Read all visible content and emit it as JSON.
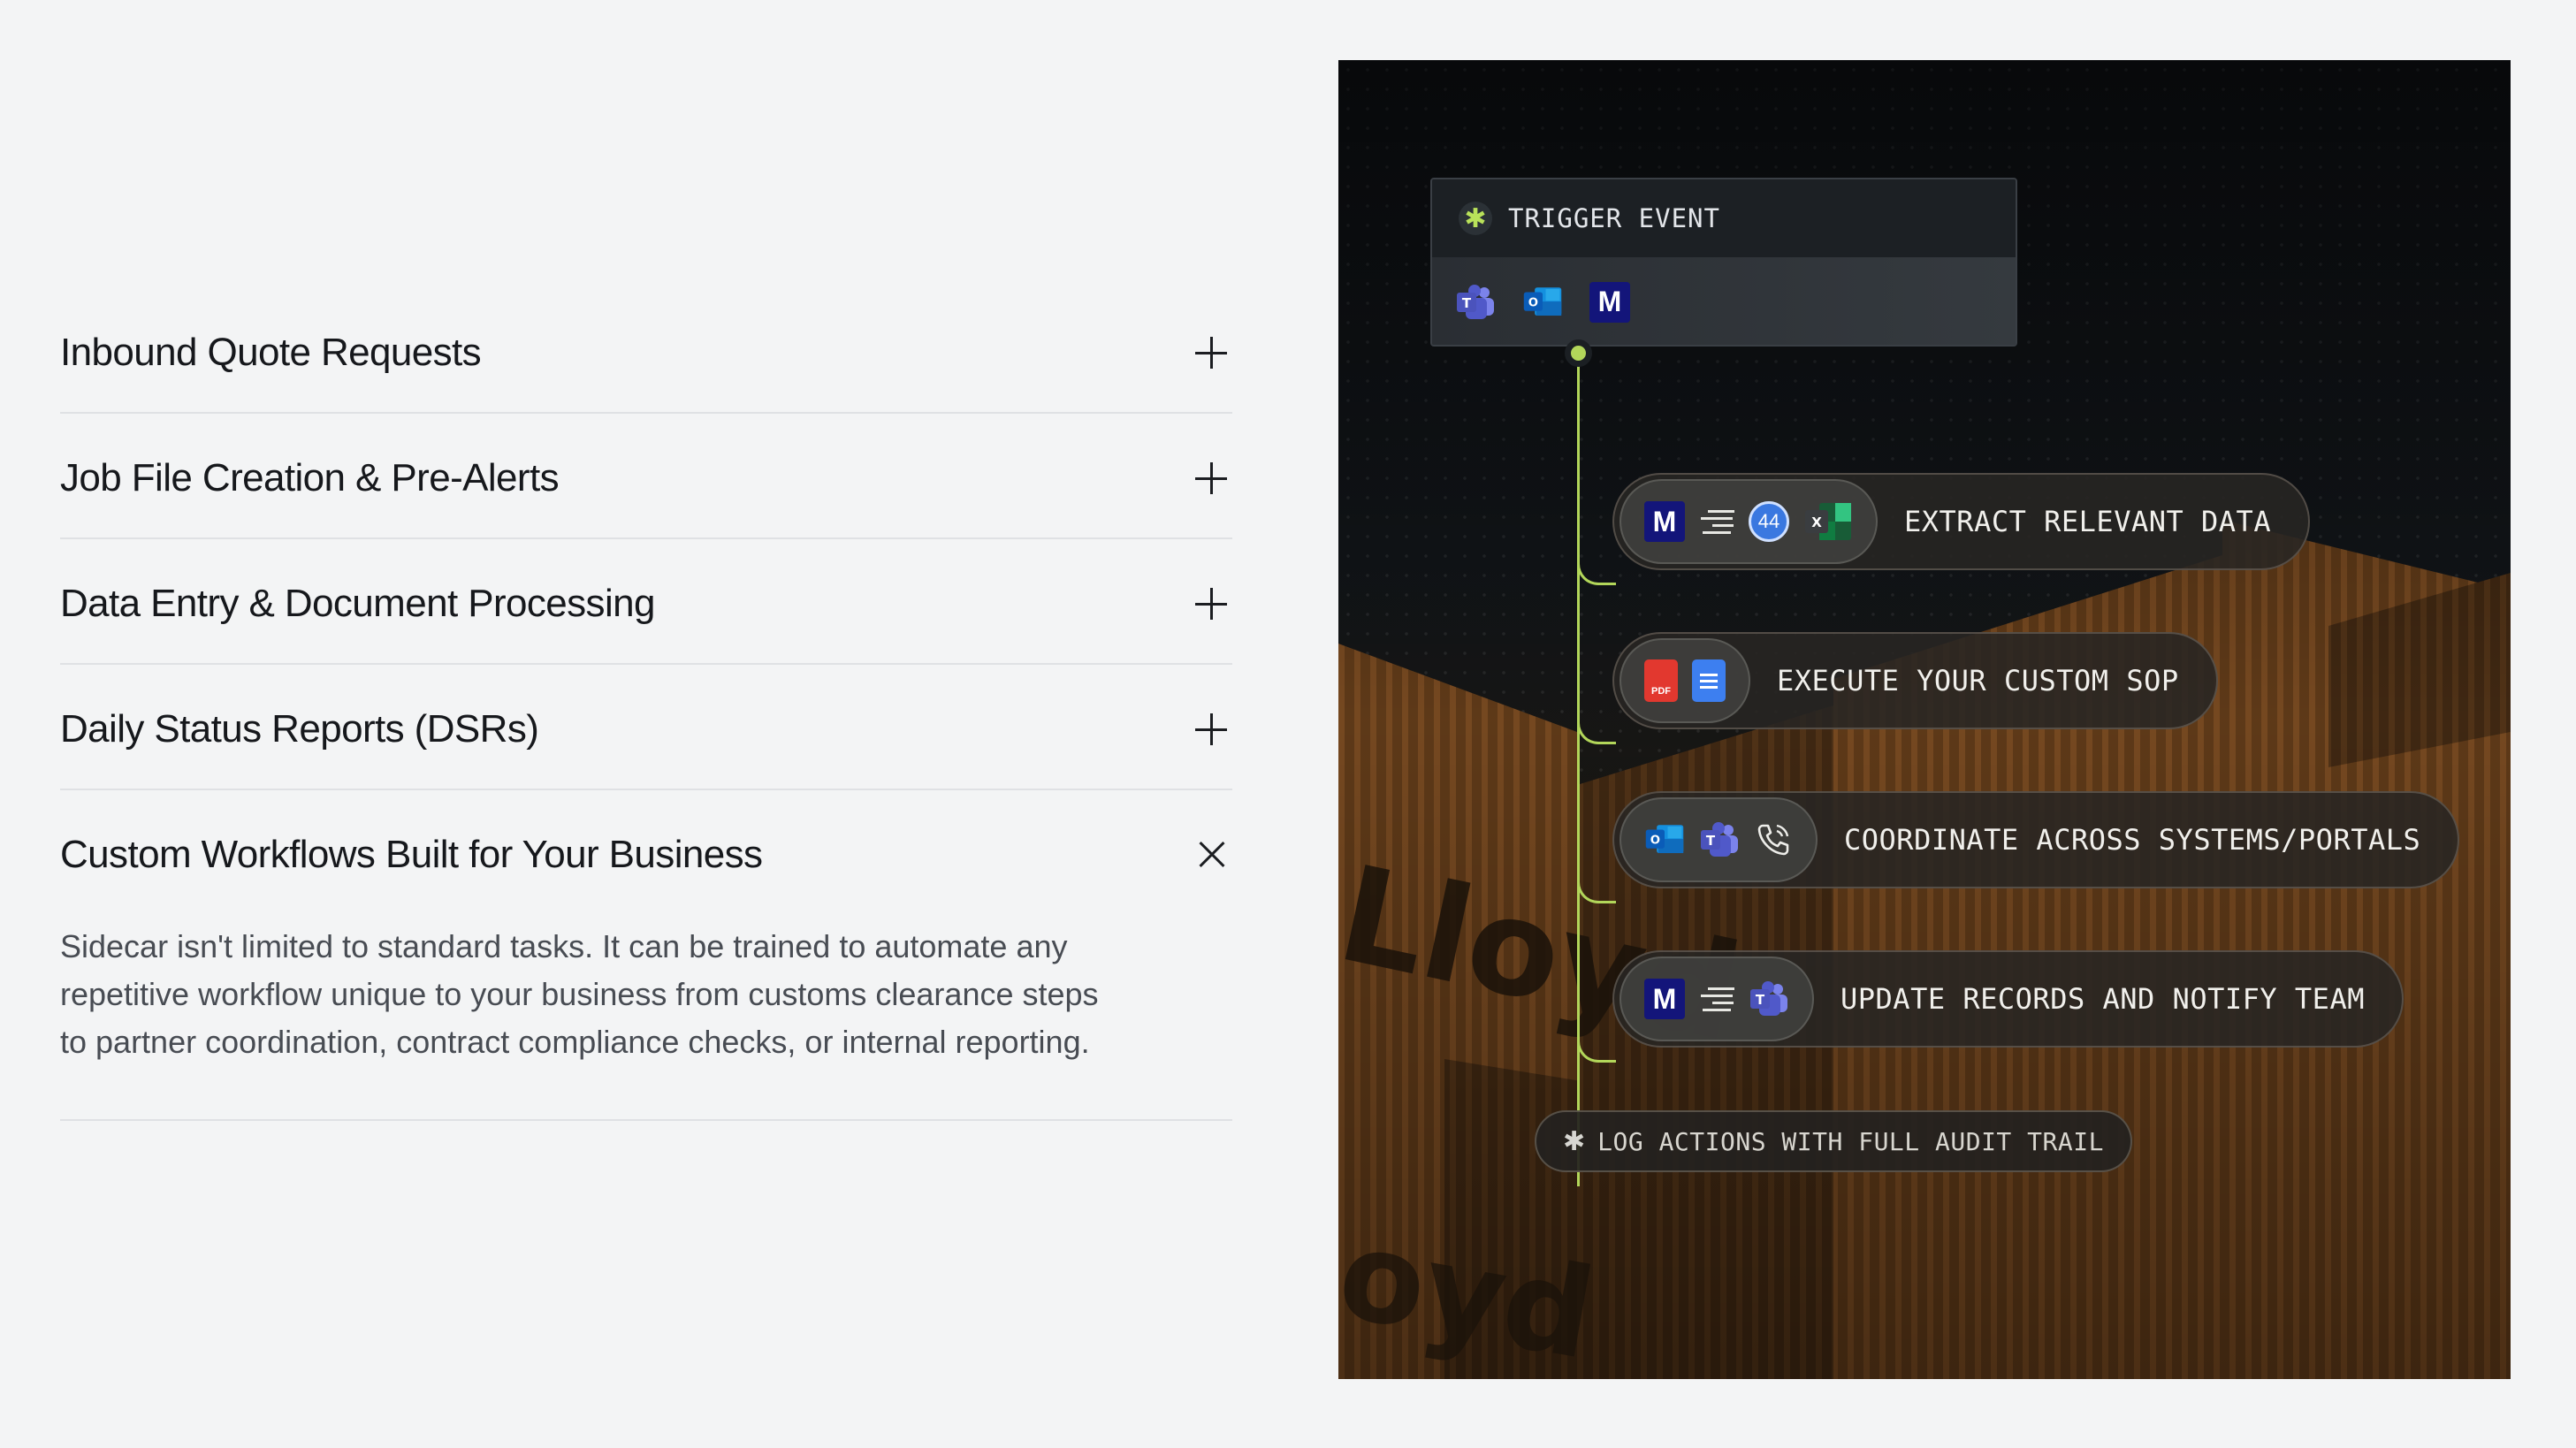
{
  "accordion": {
    "items": [
      {
        "title": "Inbound Quote Requests",
        "state": "collapsed"
      },
      {
        "title": "Job File Creation & Pre-Alerts",
        "state": "collapsed"
      },
      {
        "title": "Data Entry & Document Processing",
        "state": "collapsed"
      },
      {
        "title": "Daily Status Reports (DSRs)",
        "state": "collapsed"
      },
      {
        "title": "Custom Workflows Built for Your Business",
        "state": "expanded",
        "body": "Sidecar isn't limited to standard tasks. It can be trained to automate any repetitive workflow unique to your business from customs clearance steps to partner coordination, contract compliance checks, or internal reporting."
      }
    ]
  },
  "workflow": {
    "trigger": {
      "label": "TRIGGER EVENT",
      "icons": [
        "teams-icon",
        "outlook-icon",
        "m-logo-icon"
      ]
    },
    "steps": [
      {
        "label": "EXTRACT RELEVANT DATA",
        "icons": [
          "m-logo-icon",
          "list-icon",
          "circle-44-icon",
          "excel-icon"
        ]
      },
      {
        "label": "EXECUTE YOUR CUSTOM SOP",
        "icons": [
          "pdf-icon",
          "doc-icon"
        ]
      },
      {
        "label": "COORDINATE ACROSS SYSTEMS/PORTALS",
        "icons": [
          "outlook-icon",
          "teams-icon",
          "phone-icon"
        ]
      },
      {
        "label": "UPDATE RECORDS AND NOTIFY TEAM",
        "icons": [
          "m-logo-icon",
          "list-icon",
          "teams-icon"
        ]
      }
    ],
    "log": {
      "label": "LOG ACTIONS WITH FULL AUDIT TRAIL"
    },
    "icon_text": {
      "m": "M",
      "pdf": "PDF",
      "circle": "44",
      "excel": "X"
    },
    "background_text": {
      "brand_large": "Lloyd",
      "brand_lower": "oyd"
    },
    "colors": {
      "accent_line": "#b2d65a",
      "panel_bg": "#14181c",
      "container_brown": "#7a4a1e"
    }
  }
}
